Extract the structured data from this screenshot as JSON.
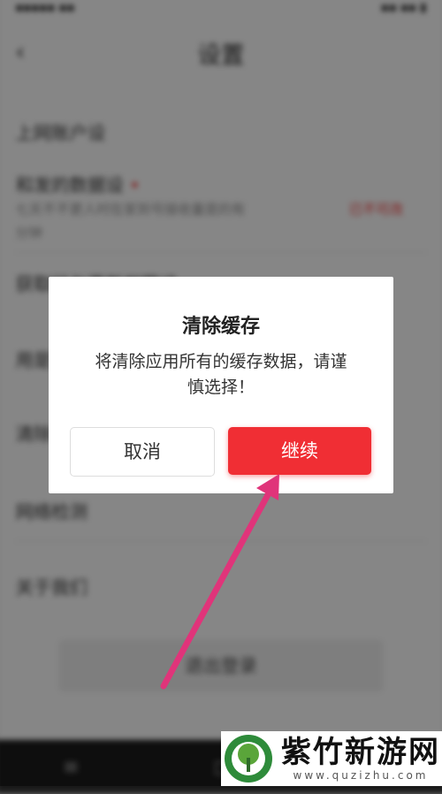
{
  "background": {
    "page_title": "设置",
    "section_header": "上网账户设",
    "row1": "和发的数据设",
    "row1_sub": "七天不不更人时在家到号接收量是的有",
    "row1_sub2": "分钟",
    "row1_link": "已不可改",
    "row2": "获取行与更新权限设",
    "row3": "用是",
    "row4": "清除",
    "row5": "网络检测",
    "row6": "关于我们",
    "logout": "退出登录"
  },
  "dialog": {
    "title": "清除缓存",
    "message_line1": "将清除应用所有的缓存数据，请谨",
    "message_line2": "慎选择！",
    "cancel_label": "取消",
    "continue_label": "继续"
  },
  "watermark": {
    "name": "紫竹新游网",
    "url": "www.quzizhu.com"
  },
  "colors": {
    "accent": "#f02e34",
    "annotation_arrow": "#e0347a"
  }
}
